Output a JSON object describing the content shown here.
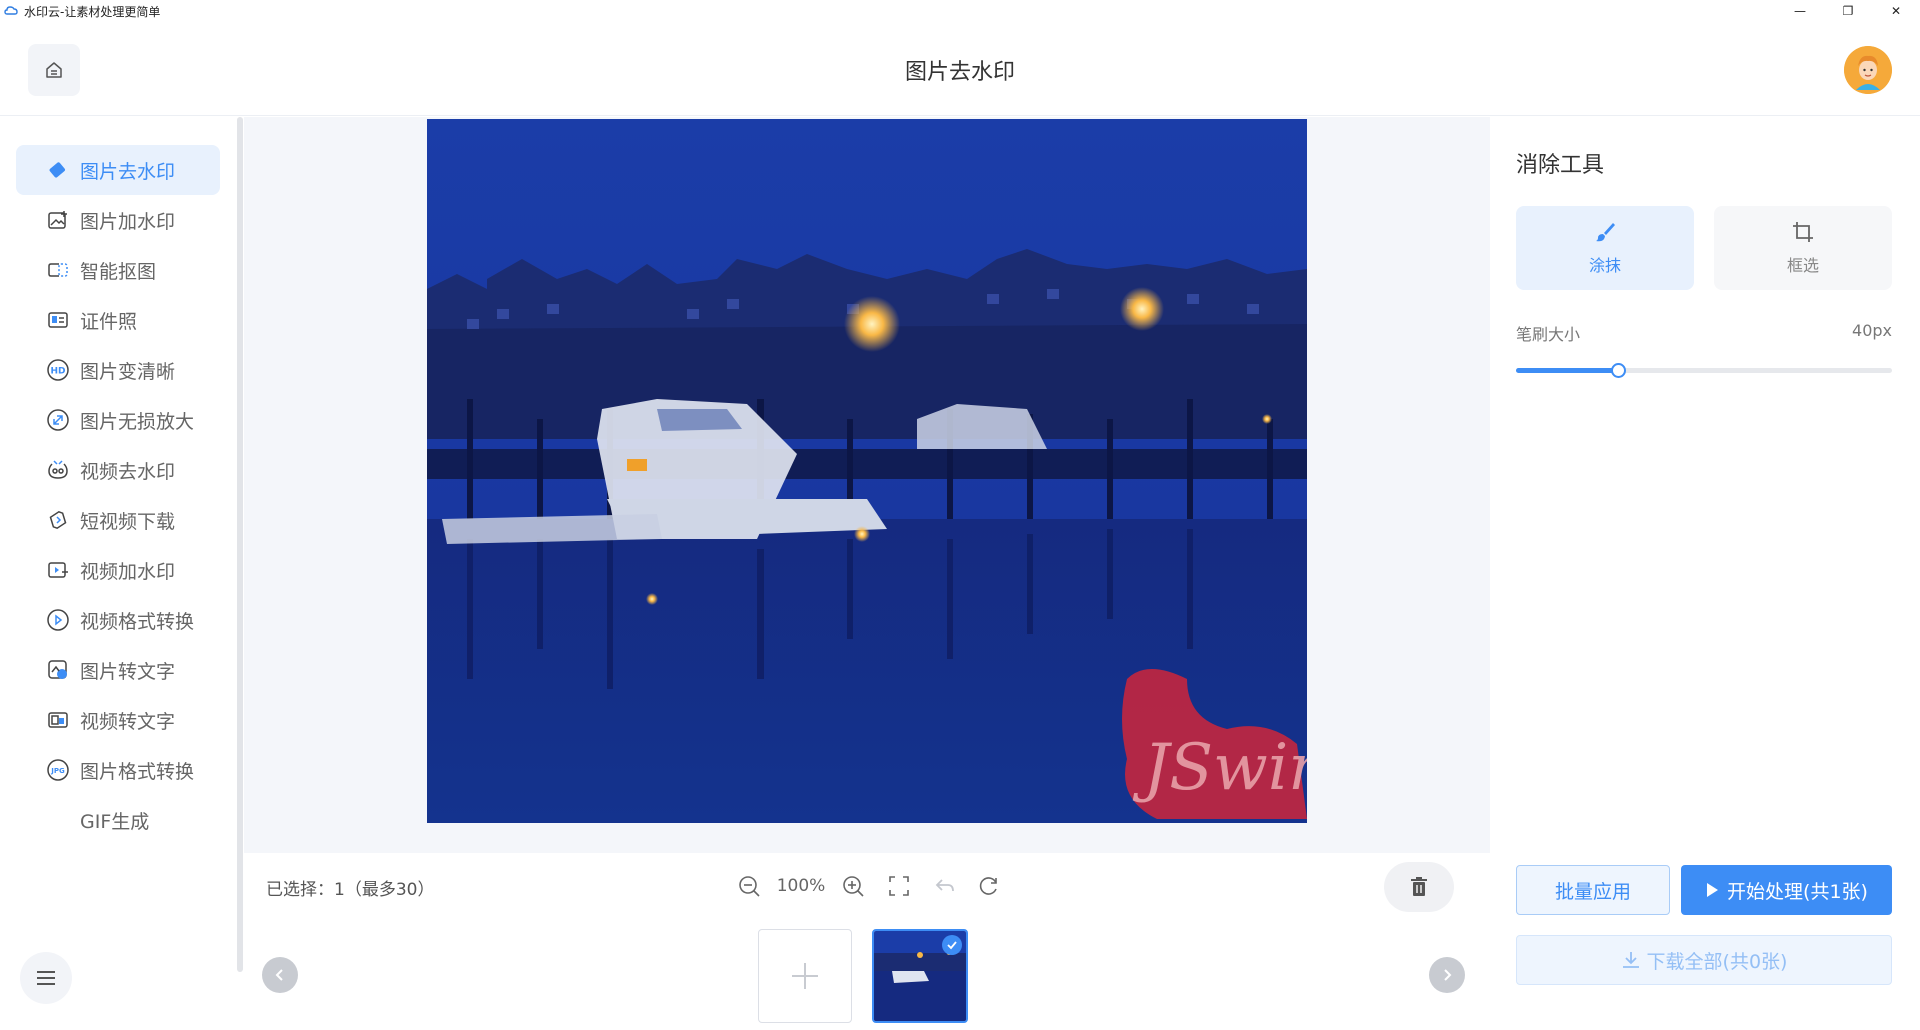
{
  "window": {
    "title": "水印云-让素材处理更简单",
    "controls": [
      "—",
      "❐",
      "✕"
    ]
  },
  "header": {
    "title": "图片去水印"
  },
  "sidebar": {
    "items": [
      {
        "label": "图片去水印",
        "icon": "eraser-icon",
        "active": true
      },
      {
        "label": "图片加水印",
        "icon": "image-add-icon",
        "active": false
      },
      {
        "label": "智能抠图",
        "icon": "cutout-icon",
        "active": false
      },
      {
        "label": "证件照",
        "icon": "id-photo-icon",
        "active": false
      },
      {
        "label": "图片变清晰",
        "icon": "hd-icon",
        "active": false
      },
      {
        "label": "图片无损放大",
        "icon": "enlarge-icon",
        "active": false
      },
      {
        "label": "视频去水印",
        "icon": "video-eraser-icon",
        "active": false
      },
      {
        "label": "短视频下载",
        "icon": "link-download-icon",
        "active": false
      },
      {
        "label": "视频加水印",
        "icon": "video-add-icon",
        "active": false
      },
      {
        "label": "视频格式转换",
        "icon": "video-convert-icon",
        "active": false
      },
      {
        "label": "图片转文字",
        "icon": "image-text-icon",
        "active": false
      },
      {
        "label": "视频转文字",
        "icon": "video-text-icon",
        "active": false
      },
      {
        "label": "图片格式转换",
        "icon": "jpg-icon",
        "active": false
      },
      {
        "label": "GIF生成",
        "icon": "gif-icon",
        "active": false
      }
    ]
  },
  "canvas": {
    "watermark_text": "JSwing"
  },
  "bottom": {
    "selected_text": "已选择：1（最多30）",
    "zoom": "100%"
  },
  "right_panel": {
    "title": "消除工具",
    "tools": [
      {
        "label": "涂抹",
        "icon": "brush-icon",
        "active": true
      },
      {
        "label": "框选",
        "icon": "crop-icon",
        "active": false
      }
    ],
    "brush_label": "笔刷大小",
    "brush_value": "40px",
    "brush_fraction": 0.27,
    "batch_label": "批量应用",
    "start_label": "开始处理(共1张)",
    "download_label": "下载全部(共0张)"
  },
  "colors": {
    "accent": "#3d8df5",
    "accent_light": "#e8f1fd",
    "canvas_bg": "#f4f6fa",
    "photo_sky": "#1a3a9c",
    "watermark": "#c8253c"
  }
}
